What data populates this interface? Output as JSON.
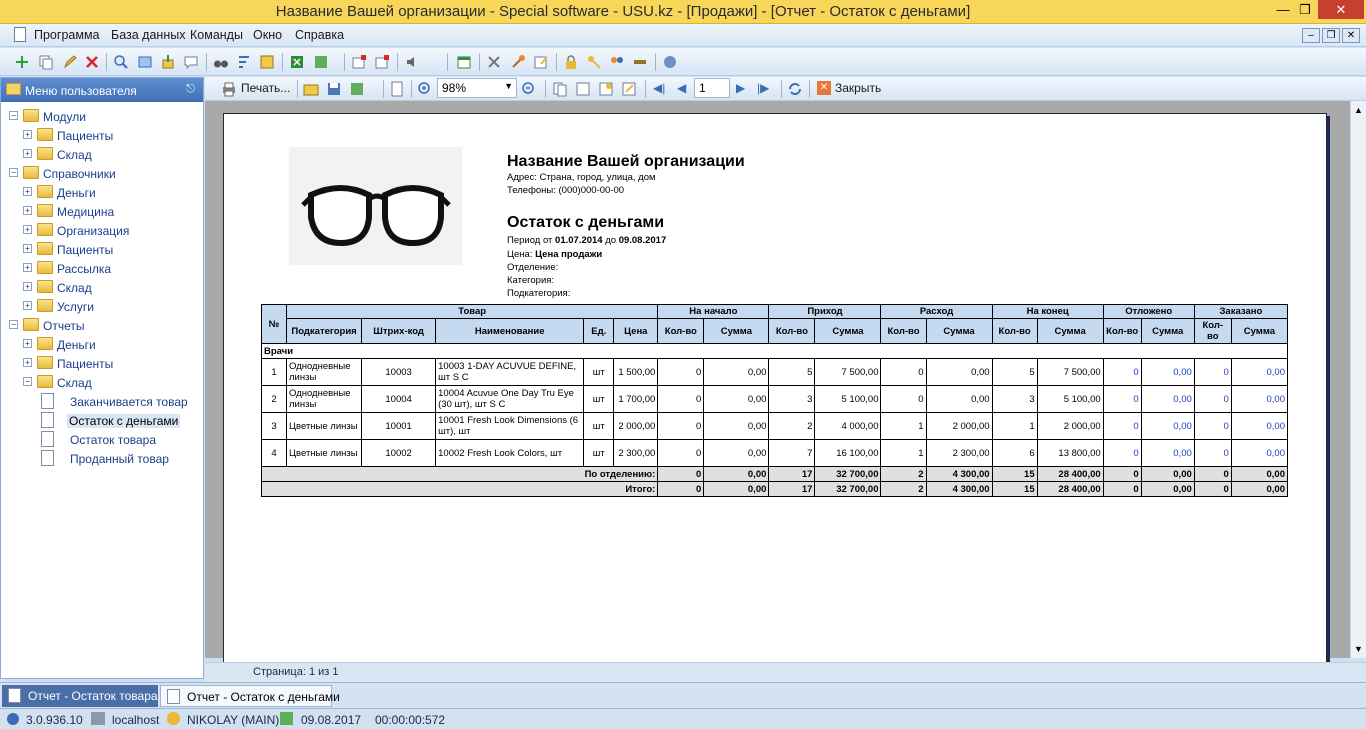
{
  "window": {
    "title": "Название Вашей организации - Special software - USU.kz - [Продажи] - [Отчет - Остаток с деньгами]"
  },
  "menu": [
    "Программа",
    "База данных",
    "Команды",
    "Окно",
    "Справка"
  ],
  "sidebar": {
    "title": "Меню пользователя",
    "tree": [
      {
        "label": "Модули",
        "level": 0,
        "kind": "folder",
        "expanded": true
      },
      {
        "label": "Пациенты",
        "level": 1,
        "kind": "folder"
      },
      {
        "label": "Склад",
        "level": 1,
        "kind": "folder"
      },
      {
        "label": "Справочники",
        "level": 0,
        "kind": "folder",
        "expanded": true
      },
      {
        "label": "Деньги",
        "level": 1,
        "kind": "folder"
      },
      {
        "label": "Медицина",
        "level": 1,
        "kind": "folder"
      },
      {
        "label": "Организация",
        "level": 1,
        "kind": "folder"
      },
      {
        "label": "Пациенты",
        "level": 1,
        "kind": "folder"
      },
      {
        "label": "Рассылка",
        "level": 1,
        "kind": "folder"
      },
      {
        "label": "Склад",
        "level": 1,
        "kind": "folder"
      },
      {
        "label": "Услуги",
        "level": 1,
        "kind": "folder"
      },
      {
        "label": "Отчеты",
        "level": 0,
        "kind": "folder",
        "expanded": true
      },
      {
        "label": "Деньги",
        "level": 1,
        "kind": "folder"
      },
      {
        "label": "Пациенты",
        "level": 1,
        "kind": "folder"
      },
      {
        "label": "Склад",
        "level": 1,
        "kind": "folder",
        "expanded": true
      },
      {
        "label": "Заканчивается товар",
        "level": 2,
        "kind": "doc"
      },
      {
        "label": "Остаток с деньгами",
        "level": 2,
        "kind": "doc",
        "selected": true
      },
      {
        "label": "Остаток товара",
        "level": 2,
        "kind": "doc"
      },
      {
        "label": "Проданный товар",
        "level": 2,
        "kind": "doc"
      }
    ]
  },
  "preview_toolbar": {
    "print_label": "Печать...",
    "zoom_value": "98%",
    "page_value": "1",
    "close_label": "Закрыть"
  },
  "report": {
    "org_name": "Название Вашей организации",
    "address": "Адрес: Страна, город, улица, дом",
    "phones": "Телефоны: (000)000-00-00",
    "title": "Остаток с деньгами",
    "period_label": "Период от ",
    "period_from": "01.07.2014",
    "period_to_label": " до ",
    "period_to": "09.08.2017",
    "price_label": "Цена: ",
    "price_value": "Цена продажи",
    "department_label": "Отделение:",
    "category_label": "Категория:",
    "subcategory_label": "Подкатегория:",
    "headers": {
      "num": "№",
      "goods": "Товар",
      "subcategory": "Подкатегория",
      "barcode": "Штрих-код",
      "name": "Наименование",
      "unit": "Ед.",
      "price": "Цена",
      "groups": [
        "На начало",
        "Приход",
        "Расход",
        "На конец",
        "Отложено",
        "Заказано"
      ],
      "qty": "Кол-во",
      "sum": "Сумма"
    },
    "group_name": "Врачи",
    "rows": [
      {
        "num": "1",
        "sub": "Однодневные линзы",
        "code": "10003",
        "name": "10003    1-DAY ACUVUE DEFINE, шт S    C",
        "unit": "шт",
        "price": "1 500,00",
        "vals": [
          "0",
          "0,00",
          "5",
          "7 500,00",
          "0",
          "0,00",
          "5",
          "7 500,00",
          "0",
          "0,00",
          "0",
          "0,00"
        ]
      },
      {
        "num": "2",
        "sub": "Однодневные линзы",
        "code": "10004",
        "name": "10004    Acuvue One Day Tru Eye (30 шт), шт S    C",
        "unit": "шт",
        "price": "1 700,00",
        "vals": [
          "0",
          "0,00",
          "3",
          "5 100,00",
          "0",
          "0,00",
          "3",
          "5 100,00",
          "0",
          "0,00",
          "0",
          "0,00"
        ]
      },
      {
        "num": "3",
        "sub": "Цветные линзы",
        "code": "10001",
        "name": "10001    Fresh Look Dimensions (6 шт), шт",
        "unit": "шт",
        "price": "2 000,00",
        "vals": [
          "0",
          "0,00",
          "2",
          "4 000,00",
          "1",
          "2 000,00",
          "1",
          "2 000,00",
          "0",
          "0,00",
          "0",
          "0,00"
        ]
      },
      {
        "num": "4",
        "sub": "Цветные линзы",
        "code": "10002",
        "name": "10002    Fresh Look Colors, шт",
        "unit": "шт",
        "price": "2 300,00",
        "vals": [
          "0",
          "0,00",
          "7",
          "16 100,00",
          "1",
          "2 300,00",
          "6",
          "13 800,00",
          "0",
          "0,00",
          "0",
          "0,00"
        ]
      }
    ],
    "totals": [
      {
        "label": "По отделению:",
        "vals": [
          "0",
          "0,00",
          "17",
          "32 700,00",
          "2",
          "4 300,00",
          "15",
          "28 400,00",
          "0",
          "0,00",
          "0",
          "0,00"
        ]
      },
      {
        "label": "Итого:",
        "vals": [
          "0",
          "0,00",
          "17",
          "32 700,00",
          "2",
          "4 300,00",
          "15",
          "28 400,00",
          "0",
          "0,00",
          "0",
          "0,00"
        ]
      }
    ]
  },
  "page_status": "Страница: 1 из 1",
  "tabs": [
    "Отчет - Остаток товара",
    "Отчет - Остаток с деньгами"
  ],
  "statusbar": {
    "version": "3.0.936.10",
    "host": "localhost",
    "user": "NIKOLAY (MAIN)",
    "date": "09.08.2017",
    "timer": "00:00:00:572"
  },
  "colors": {
    "title_bar": "#f7d65a",
    "header_fill": "#c5d9f1",
    "link_blue": "#1a3cc0"
  }
}
